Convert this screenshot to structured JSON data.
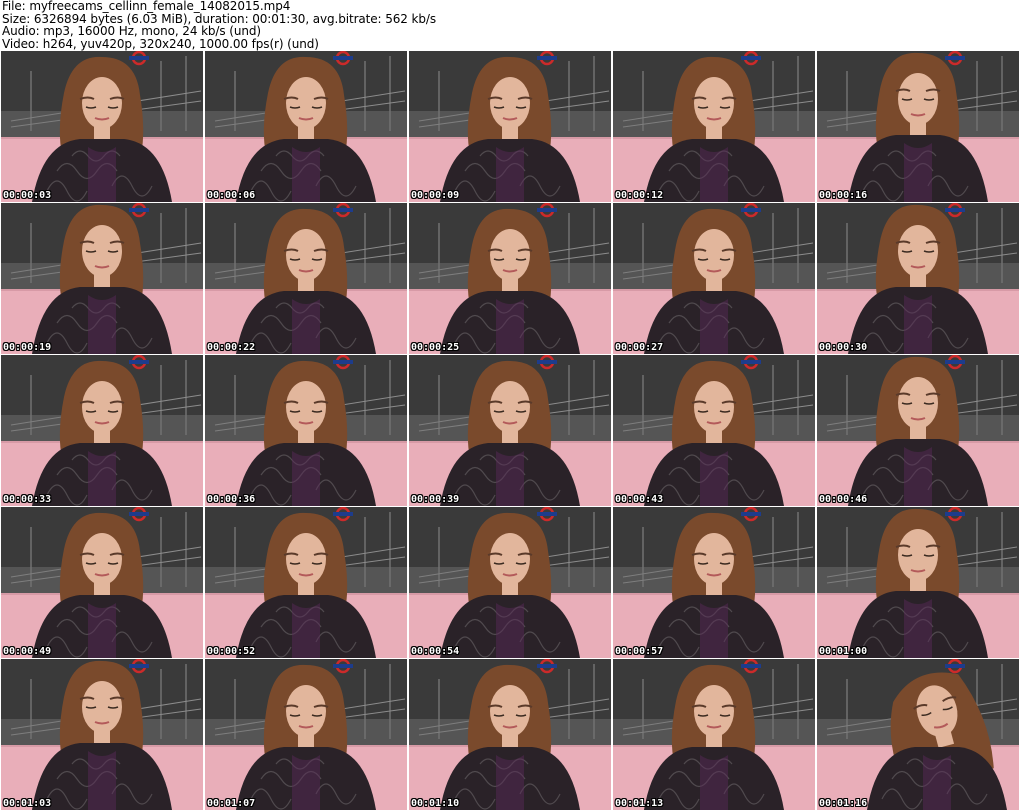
{
  "header": {
    "file": "File: myfreecams_cellinn_female_14082015.mp4",
    "size": "Size: 6326894 bytes (6.03 MiB), duration: 00:01:30, avg.bitrate: 562 kb/s",
    "audio": "Audio: mp3, 16000 Hz, mono, 24 kb/s (und)",
    "video": "Video: h264, yuv420p, 320x240, 1000.00 fps(r) (und)"
  },
  "frames": [
    {
      "timestamp": "00:00:03",
      "pose": "down"
    },
    {
      "timestamp": "00:00:06",
      "pose": "down"
    },
    {
      "timestamp": "00:00:09",
      "pose": "down"
    },
    {
      "timestamp": "00:00:12",
      "pose": "down"
    },
    {
      "timestamp": "00:00:16",
      "pose": "front"
    },
    {
      "timestamp": "00:00:19",
      "pose": "front"
    },
    {
      "timestamp": "00:00:22",
      "pose": "down"
    },
    {
      "timestamp": "00:00:25",
      "pose": "down"
    },
    {
      "timestamp": "00:00:27",
      "pose": "down"
    },
    {
      "timestamp": "00:00:30",
      "pose": "front"
    },
    {
      "timestamp": "00:00:33",
      "pose": "down"
    },
    {
      "timestamp": "00:00:36",
      "pose": "down"
    },
    {
      "timestamp": "00:00:39",
      "pose": "down"
    },
    {
      "timestamp": "00:00:43",
      "pose": "down"
    },
    {
      "timestamp": "00:00:46",
      "pose": "front"
    },
    {
      "timestamp": "00:00:49",
      "pose": "down"
    },
    {
      "timestamp": "00:00:52",
      "pose": "down"
    },
    {
      "timestamp": "00:00:54",
      "pose": "down"
    },
    {
      "timestamp": "00:00:57",
      "pose": "down"
    },
    {
      "timestamp": "00:01:00",
      "pose": "front"
    },
    {
      "timestamp": "00:01:03",
      "pose": "front"
    },
    {
      "timestamp": "00:01:07",
      "pose": "down"
    },
    {
      "timestamp": "00:01:10",
      "pose": "down"
    },
    {
      "timestamp": "00:01:13",
      "pose": "down"
    },
    {
      "timestamp": "00:01:16",
      "pose": "side"
    }
  ],
  "colors": {
    "wall": "#e9aeb9",
    "poster_bg": "#3a3a3a",
    "hair": "#7a4a2c",
    "skin": "#e2b69c",
    "top": "#2a2228",
    "logo_red": "#cc2a2a"
  }
}
